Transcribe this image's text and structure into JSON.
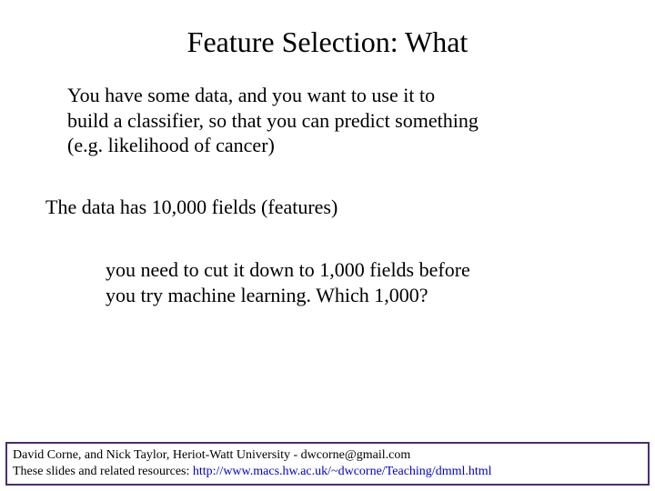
{
  "title": "Feature Selection:  What",
  "para1_line1": "You have some data, and you want to use it to",
  "para1_line2": "build a classifier, so that you can predict something",
  "para1_line3": " (e.g. likelihood of cancer)",
  "para2": "The data has 10,000 fields (features)",
  "para3_line1": "you need to cut it down to 1,000 fields before",
  "para3_line2": "you try machine learning. Which 1,000?",
  "footer_line1": "David Corne, and Nick Taylor,  Heriot-Watt University  -  dwcorne@gmail.com",
  "footer_line2_prefix": "These slides and related resources:  ",
  "footer_link": "http://www.macs.hw.ac.uk/~dwcorne/Teaching/dmml.html"
}
